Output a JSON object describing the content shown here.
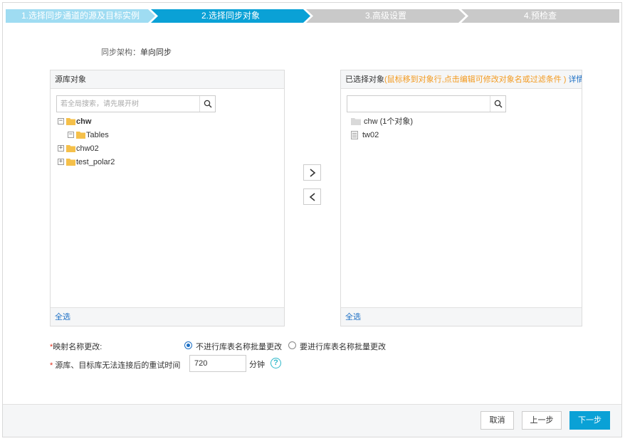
{
  "steps": [
    {
      "label": "1.选择同步通道的源及目标实例",
      "state": "done"
    },
    {
      "label": "2.选择同步对象",
      "state": "active"
    },
    {
      "label": "3.高级设置",
      "state": "todo"
    },
    {
      "label": "4.预检查",
      "state": "todo"
    }
  ],
  "colors": {
    "done": "#9fdcf2",
    "active": "#0aa1d6",
    "todo": "#c9c9c9"
  },
  "arch": {
    "label": "同步架构：",
    "value": "单向同步"
  },
  "source_panel": {
    "title": "源库对象",
    "search_placeholder": "若全局搜索，请先展开树",
    "tree": [
      {
        "label": "chw",
        "toggle": "−",
        "bold": true
      },
      {
        "label": "Tables",
        "toggle": "−"
      },
      {
        "label": "chw02",
        "toggle": "+"
      },
      {
        "label": "test_polar2",
        "toggle": "+"
      }
    ],
    "select_all": "全选"
  },
  "target_panel": {
    "title": "已选择对象",
    "hint": "(鼠标移到对象行,点击编辑可修改对象名或过滤条件 )",
    "detail_link": "详情点我",
    "search_value": "",
    "tree": [
      {
        "label": "chw (1个对象)"
      },
      {
        "label": "tw02"
      }
    ],
    "select_all": "全选"
  },
  "transfer": {
    "add": "›",
    "remove": "‹"
  },
  "mapping": {
    "label": "映射名称更改:",
    "options": [
      "不进行库表名称批量更改",
      "要进行库表名称批量更改"
    ],
    "selected": 0
  },
  "retry": {
    "label": "源库、目标库无法连接后的重试时间",
    "value": "720",
    "unit": "分钟",
    "help": "?"
  },
  "footer": {
    "cancel": "取消",
    "prev": "上一步",
    "next": "下一步"
  }
}
